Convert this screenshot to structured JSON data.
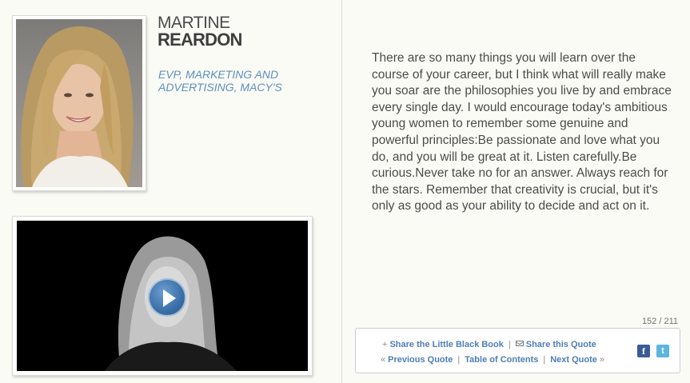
{
  "profile": {
    "first_name": "MARTINE",
    "last_name": "REARDON",
    "title_line1": "EVP, MARKETING AND",
    "title_line2": "ADVERTISING, MACY'S"
  },
  "quote": {
    "text": "There are so many things you will learn over the course of your career, but I think what will really make you soar are the philosophies you live by and embrace every single day. I would encourage today's ambitious young women to remember some genuine and powerful principles:Be passionate and love what you do, and you will be great at it. Listen carefully.Be curious.Never take no for an answer. Always reach for the stars. Remember that creativity is crucial, but it's only as good as your ability to decide and act on it."
  },
  "pagination": {
    "count": "152 / 211"
  },
  "share": {
    "book_prefix": "+",
    "book_label": "Share the Little Black Book",
    "quote_label": "Share this Quote",
    "prev_prefix": "«",
    "prev_label": "Previous Quote",
    "toc_label": "Table of Contents",
    "next_label": "Next Quote",
    "next_suffix": "»",
    "separator": "|"
  },
  "social": {
    "facebook_glyph": "f",
    "twitter_glyph": "t"
  },
  "icons": {
    "play": "play-icon",
    "mail": "envelope-icon",
    "facebook": "facebook-icon",
    "twitter": "twitter-icon"
  },
  "colors": {
    "accent": "#5d8fc0",
    "link": "#4f7eb5",
    "facebook": "#3b5a9a",
    "twitter": "#5bb5e0"
  }
}
